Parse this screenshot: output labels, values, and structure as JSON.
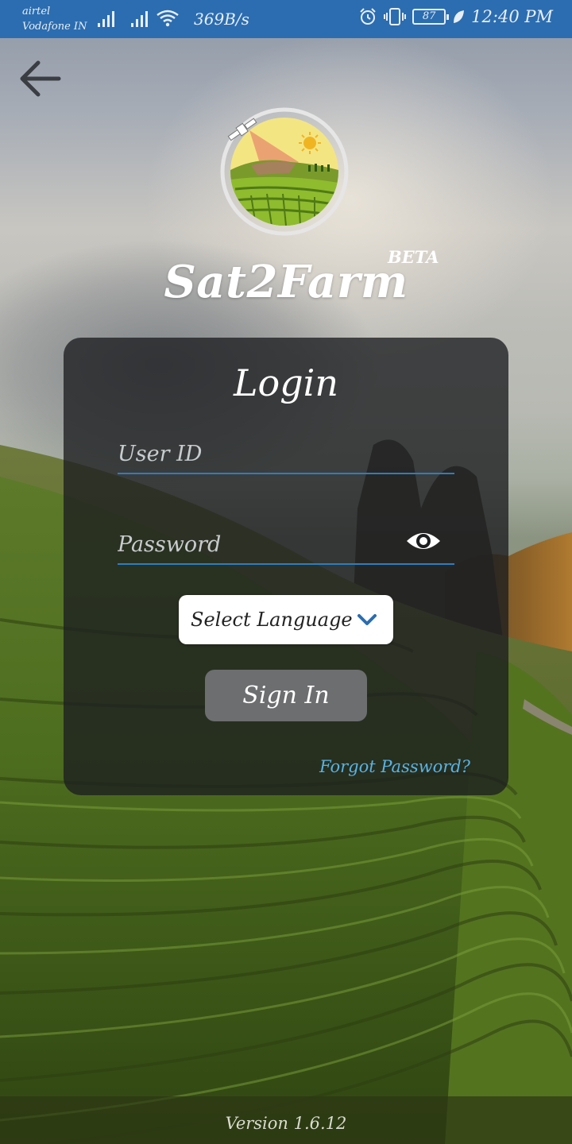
{
  "status_bar": {
    "carrier_1": "airtel",
    "carrier_2": "Vodafone IN",
    "net_speed": "369B/s",
    "battery": "87",
    "time": "12:40 PM",
    "bg_color": "#2b6db0"
  },
  "icons": {
    "back": "arrow-left-icon",
    "eye": "eye-icon",
    "dropdown": "chevron-down-icon",
    "alarm": "alarm-icon",
    "vibrate": "vibrate-icon",
    "wifi": "wifi-icon",
    "signal": "signal-icon",
    "leaf": "leaf-icon"
  },
  "header": {
    "app_name": "Sat2Farm",
    "badge": "BETA"
  },
  "login": {
    "title": "Login",
    "userid_placeholder": "User ID",
    "userid_value": "",
    "password_placeholder": "Password",
    "password_value": "",
    "language_label": "Select Language",
    "signin_label": "Sign In",
    "forgot_label": "Forgot Password?"
  },
  "footer": {
    "version": "Version 1.6.12"
  },
  "colors": {
    "accent_line": "#2e7dc0",
    "link": "#5ab2e2",
    "card_bg": "rgba(28,30,32,0.78)",
    "button_bg": "#6c6e70"
  }
}
